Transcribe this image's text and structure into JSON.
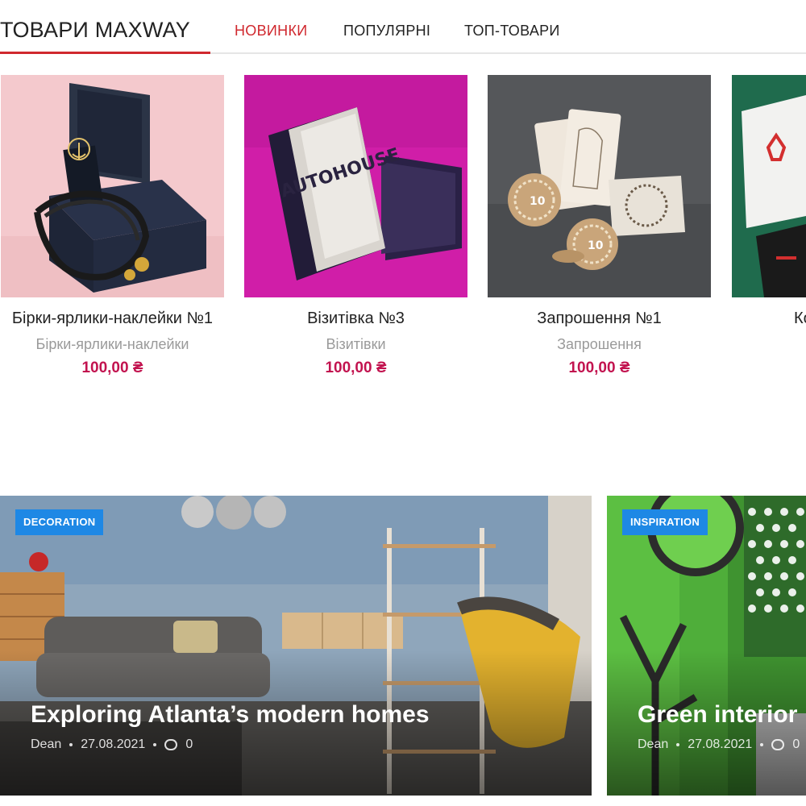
{
  "tabs": {
    "title": "ТОВАРИ MAXWAY",
    "items": [
      "НОВИНКИ",
      "ПОПУЛЯРНІ",
      "ТОП-ТОВАРИ"
    ],
    "accent_color": "#d0282e"
  },
  "products": [
    {
      "name": "Бірки-ярлики-наклейки №1",
      "category": "Бірки-ярлики-наклейки",
      "price": "100,00 ₴"
    },
    {
      "name": "Візитівка №3",
      "category": "Візитівки",
      "price": "100,00 ₴"
    },
    {
      "name": "Запрошення №1",
      "category": "Запрошення",
      "price": "100,00 ₴"
    },
    {
      "name": "Ко",
      "category": "",
      "price": ""
    }
  ],
  "product_image_text": {
    "business_card": "AUTOHOUSE",
    "chip_number": "10"
  },
  "price_color": "#c2134f",
  "posts": [
    {
      "badge": "DECORATION",
      "title": "Exploring Atlanta’s modern homes",
      "author": "Dean",
      "date": "27.08.2021",
      "comments": "0"
    },
    {
      "badge": "INSPIRATION",
      "title": "Green interior",
      "author": "Dean",
      "date": "27.08.2021",
      "comments": "0"
    }
  ],
  "badge_color": "#1e88e5"
}
